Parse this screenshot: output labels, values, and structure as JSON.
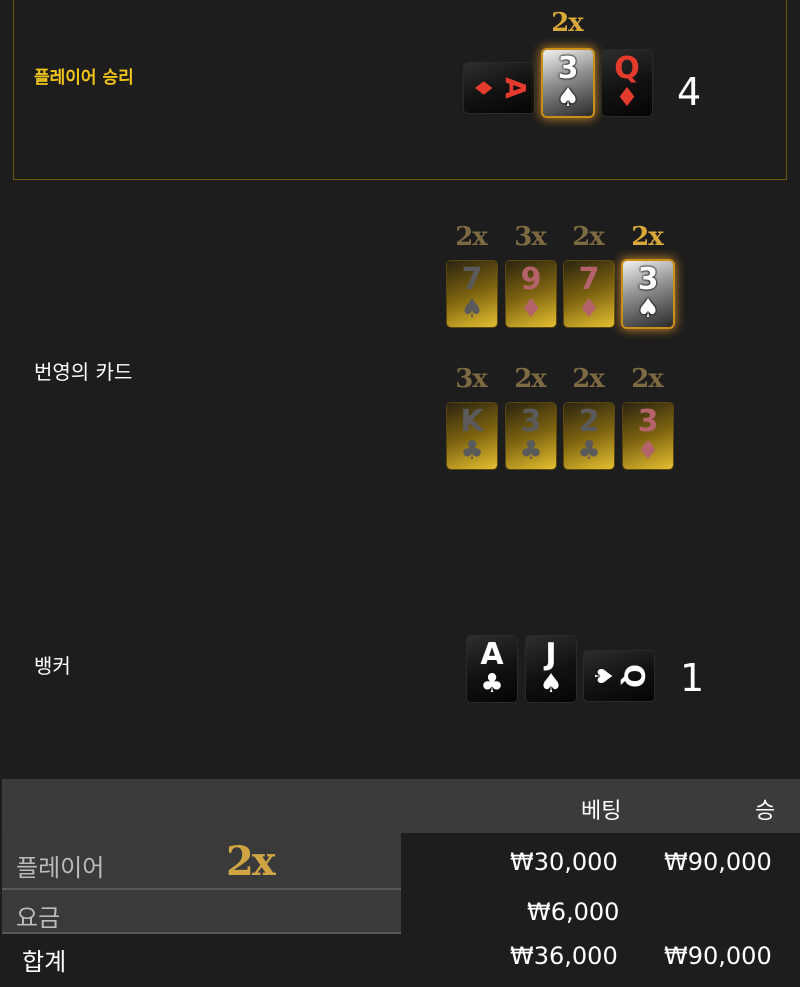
{
  "player": {
    "label": "플레이어 승리",
    "multiplier": "2x",
    "cards": [
      {
        "rank": "A",
        "suit": "♦"
      },
      {
        "rank": "3",
        "suit": "♠"
      },
      {
        "rank": "Q",
        "suit": "♦"
      }
    ],
    "score": "4"
  },
  "lightning": {
    "label": "번영의 카드",
    "row1": [
      {
        "mult": "2x",
        "rank": "7",
        "suit": "♠"
      },
      {
        "mult": "3x",
        "rank": "9",
        "suit": "♦"
      },
      {
        "mult": "2x",
        "rank": "7",
        "suit": "♦"
      },
      {
        "mult": "2x",
        "rank": "3",
        "suit": "♠"
      }
    ],
    "row2": [
      {
        "mult": "3x",
        "rank": "K",
        "suit": "♣"
      },
      {
        "mult": "2x",
        "rank": "3",
        "suit": "♣"
      },
      {
        "mult": "2x",
        "rank": "2",
        "suit": "♣"
      },
      {
        "mult": "2x",
        "rank": "3",
        "suit": "♦"
      }
    ]
  },
  "banker": {
    "label": "뱅커",
    "cards": [
      {
        "rank": "A",
        "suit": "♣"
      },
      {
        "rank": "J",
        "suit": "♠"
      },
      {
        "rank": "Q",
        "suit": "♠"
      }
    ],
    "score": "1"
  },
  "table": {
    "headers": {
      "bet": "베팅",
      "win": "승"
    },
    "rows": [
      {
        "label": "플레이어",
        "multiplier": "2x",
        "bet": "₩30,000",
        "win": "₩90,000"
      },
      {
        "label": "요금",
        "bet": "₩6,000",
        "win": ""
      }
    ],
    "total": {
      "label": "합계",
      "bet": "₩36,000",
      "win": "₩90,000"
    }
  },
  "colors": {
    "gold_label": "#f0c419",
    "red_suit": "#e53b2c",
    "multiplier_gold": "#cfa445"
  }
}
